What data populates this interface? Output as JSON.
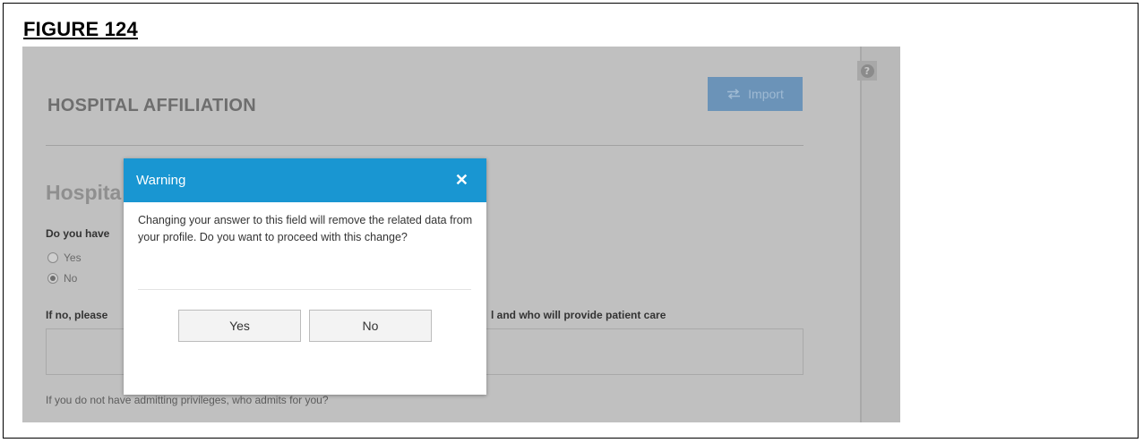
{
  "figure_label": "FIGURE 124",
  "page": {
    "title": "HOSPITAL AFFILIATION",
    "import_label": "Import",
    "section_title": "Hospita",
    "question1": "Do you have",
    "options": [
      {
        "label": "Yes",
        "selected": false
      },
      {
        "label": "No",
        "selected": true
      }
    ],
    "question2_left": "If no, please",
    "question2_right": "l and who will provide patient care",
    "question3": "If you do not have admitting privileges, who admits for you?"
  },
  "modal": {
    "title": "Warning",
    "message": "Changing your answer to this field will remove the related data from your profile. Do you want to proceed with this change?",
    "yes_label": "Yes",
    "no_label": "No"
  },
  "colors": {
    "modal_header": "#1996d2",
    "overlay_gray": "#c0c0c0",
    "import_button": "#6b93b8"
  }
}
